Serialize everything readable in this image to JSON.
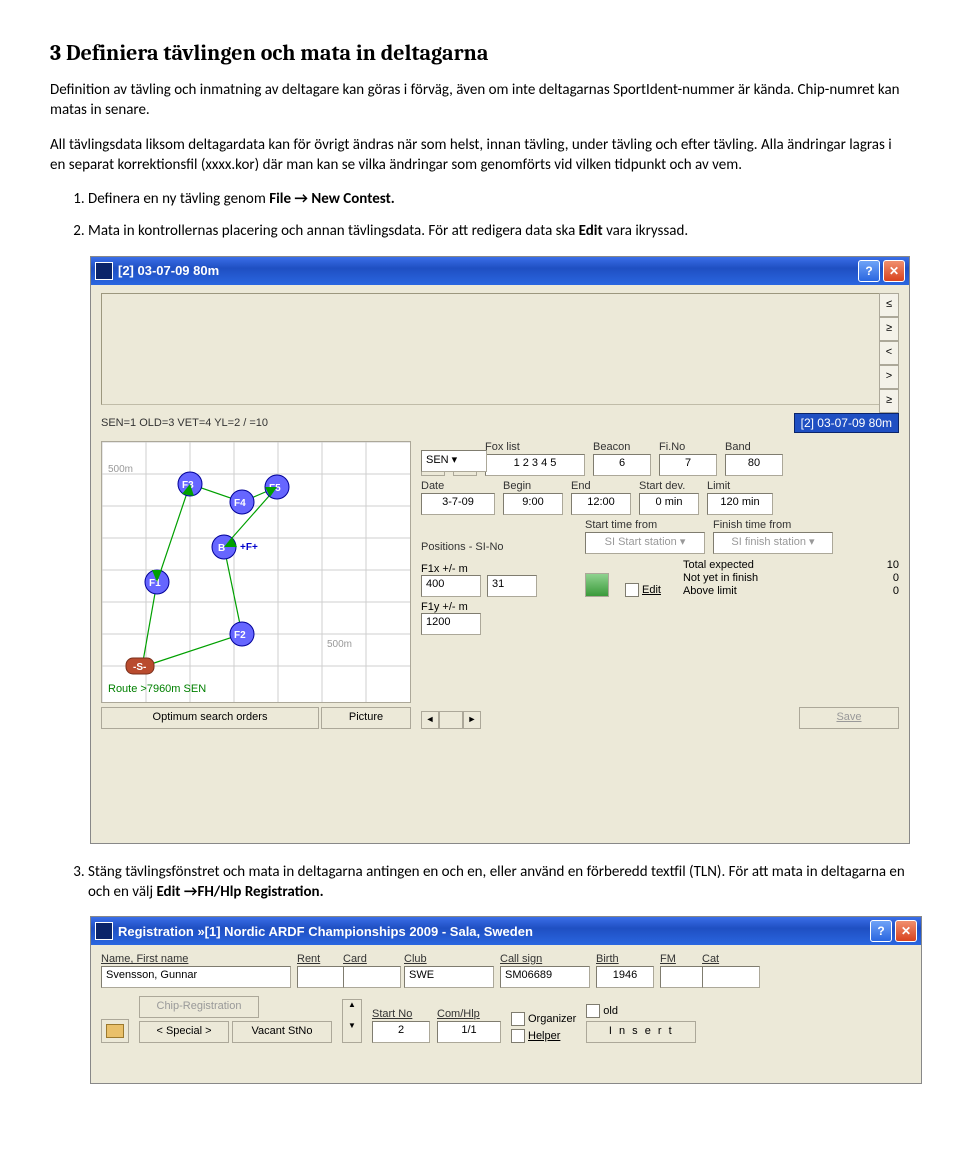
{
  "heading": "3  Definiera tävlingen och mata in deltagarna",
  "para1": "Definition av tävling och inmatning av deltagare kan göras i förväg, även om inte deltagarnas SportIdent-nummer är kända. Chip-numret kan matas in senare.",
  "para2": "All tävlingsdata liksom deltagardata kan för övrigt ändras när som helst, innan tävling, under tävling och efter tävling. Alla ändringar lagras i en separat korrektionsfil (xxxx.kor) där man kan se vilka ändringar som genomförts vid vilken tidpunkt och av vem.",
  "li1a": "Definera en ny tävling genom ",
  "li1b": "File → New Contest.",
  "li2a": "Mata in kontrollernas placering och annan tävlingsdata. För att redigera data ska ",
  "li2b": "Edit",
  "li2c": " vara ikryssad.",
  "li3a": "Stäng tävlingsfönstret och mata in deltagarna antingen en och en, eller använd en förberedd textfil (TLN). För att mata in deltagarna en och en välj ",
  "li3b": "Edit →FH/Hlp Registration.",
  "contest": {
    "title": "[2] 03-07-09  80m",
    "side": [
      "≤",
      "≥",
      "<",
      ">",
      "≥"
    ],
    "eq": "SEN=1 OLD=3 VET=4 YL=2 /  =10",
    "bluebox": "[2] 03-07-09  80m",
    "sen": "SEN",
    "foxlist": "Fox list",
    "foxlist_v": "1 2 3 4 5",
    "beacon": "Beacon",
    "beacon_v": "6",
    "fino": "Fi.No",
    "fino_v": "7",
    "band": "Band",
    "band_v": "80",
    "date": "Date",
    "date_v": "3-7-09",
    "begin": "Begin",
    "begin_v": "9:00",
    "end": "End",
    "end_v": "12:00",
    "startdev": "Start dev.",
    "startdev_v": "0 min",
    "limit": "Limit",
    "limit_v": "120 min",
    "positions": "Positions  -  SI-No",
    "startfrom": "Start time from",
    "startfrom_v": "SI Start station",
    "finishfrom": "Finish time from",
    "finishfrom_v": "SI finish station",
    "f1x": "F1x  +/- m",
    "f1x_a": "400",
    "f1x_b": "31",
    "f1y": "F1y  +/- m",
    "f1y_a": "1200",
    "edit": "Edit",
    "stat1": "Total expected",
    "stat1v": "10",
    "stat2": "Not yet in finish",
    "stat2v": "0",
    "stat3": "Above limit",
    "stat3v": "0",
    "optbtn": "Optimum search orders",
    "picbtn": "Picture",
    "savebtn": "Save",
    "route": "Route >7960m  SEN",
    "m500": "500m",
    "m500b": "500m"
  },
  "reg": {
    "title": "Registration  »[1]  Nordic ARDF Championships 2009 - Sala, Sweden",
    "name": "Name, First name",
    "name_v": "Svensson, Gunnar",
    "rent": "Rent",
    "card": "Card",
    "club": "Club",
    "club_v": "SWE",
    "call": "Call sign",
    "call_v": "SM06689",
    "birth": "Birth",
    "birth_v": "1946",
    "fm": "FM",
    "cat": "Cat",
    "chipreg": "Chip-Registration",
    "special": "< Special >",
    "vacant": "Vacant StNo",
    "startno": "Start No",
    "startno_v": "2",
    "comhlp": "Com/Hlp",
    "comhlp_v": "1/1",
    "organizer": "Organizer",
    "old": "old",
    "helper": "Helper",
    "insert": "I n s e r t"
  }
}
